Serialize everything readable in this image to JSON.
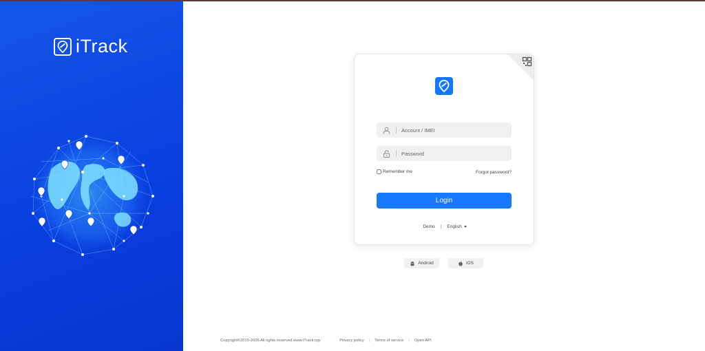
{
  "brand": {
    "name": "iTrack",
    "logo_icon": "location-pin-icon"
  },
  "login": {
    "account_placeholder": "Account / IMEI",
    "password_placeholder": "Password",
    "remember_label": "Remember me",
    "forgot_label": "Forgot password?",
    "login_label": "Login",
    "demo_label": "Demo",
    "separator": "|",
    "language": "English"
  },
  "apps": {
    "android_label": "Android",
    "ios_label": "iOS"
  },
  "footer": {
    "copyright": "Copyright©2015-2026 All rights reserved.www.iTrack.top",
    "privacy": "Privacy policy",
    "terms": "Terms of service",
    "api": "Open API",
    "separator": "|"
  },
  "colors": {
    "primary": "#1677ff",
    "left_panel": "#0a3fe0"
  }
}
